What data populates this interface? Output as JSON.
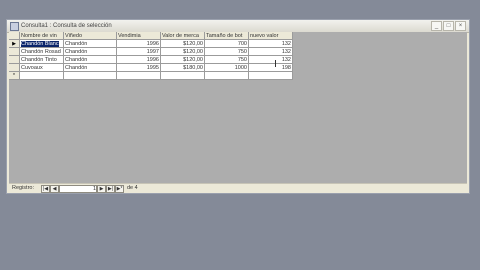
{
  "window": {
    "title": "Consulta1 : Consulta de selección",
    "btn_min": "_",
    "btn_max": "□",
    "btn_close": "×"
  },
  "grid": {
    "columns": [
      "Nombre de vin",
      "Viñedo",
      "Vendimia",
      "Valor de merca",
      "Tamaño de bot",
      "nuevo valor"
    ],
    "rows": [
      {
        "marker": "▶",
        "cells": [
          "Chandón Blanc",
          "Chandón",
          "1996",
          "$120,00",
          "700",
          "132"
        ]
      },
      {
        "marker": "",
        "cells": [
          "Chandón Rosad",
          "Chandón",
          "1997",
          "$120,00",
          "750",
          "132"
        ]
      },
      {
        "marker": "",
        "cells": [
          "Chandón Tinto",
          "Chandón",
          "1996",
          "$120,00",
          "750",
          "132"
        ]
      },
      {
        "marker": "",
        "cells": [
          "Cuvoaux",
          "Chandón",
          "1995",
          "$180,00",
          "1000",
          "198"
        ]
      }
    ],
    "new_row_marker": "*"
  },
  "nav": {
    "label": "Registro:",
    "first": "|◀",
    "prev": "◀",
    "current": "1",
    "next": "▶",
    "last": "▶|",
    "new": "▶*",
    "of_label": "de 4"
  }
}
